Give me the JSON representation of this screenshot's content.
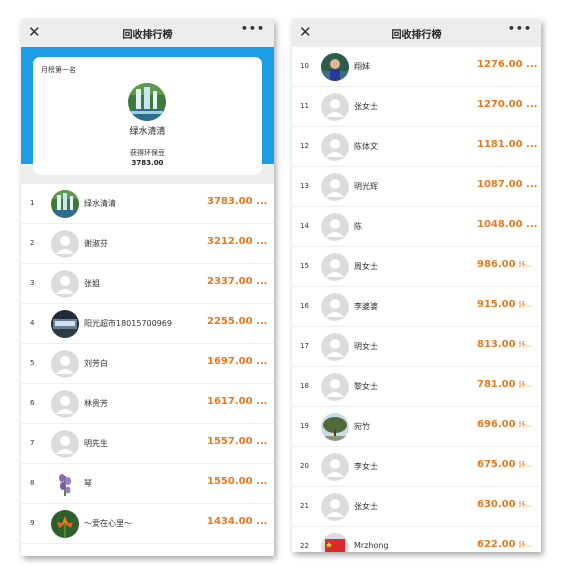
{
  "left_panel": {
    "title": "回收排行榜",
    "close_icon": "close-icon",
    "more_icon": "more-icon",
    "top_card": {
      "label": "月榜第一名",
      "name": "绿水清清",
      "caption": "获得环保豆",
      "value": "3783.00"
    },
    "rows": [
      {
        "rank": "1",
        "name": "绿水清清",
        "value": "3783.00 ...",
        "avatar": "waterfall"
      },
      {
        "rank": "2",
        "name": "谢淑芬",
        "value": "3212.00 ...",
        "avatar": "default"
      },
      {
        "rank": "3",
        "name": "张姐",
        "value": "2337.00 ...",
        "avatar": "default"
      },
      {
        "rank": "4",
        "name": "阳光超市18015700969",
        "value": "2255.00 ...",
        "avatar": "storefront"
      },
      {
        "rank": "5",
        "name": "刘芳白",
        "value": "1697.00 ...",
        "avatar": "default"
      },
      {
        "rank": "6",
        "name": "林贵芳",
        "value": "1617.00 ...",
        "avatar": "default"
      },
      {
        "rank": "7",
        "name": "明先生",
        "value": "1557.00 ...",
        "avatar": "default"
      },
      {
        "rank": "8",
        "name": "琴",
        "value": "1550.00 ...",
        "avatar": "flower"
      },
      {
        "rank": "9",
        "name": "～爱在心里～",
        "value": "1434.00 ...",
        "avatar": "lily"
      }
    ]
  },
  "right_panel": {
    "title": "回收排行榜",
    "close_icon": "close-icon",
    "more_icon": "more-icon",
    "rows": [
      {
        "rank": "10",
        "name": "翔妹",
        "value": "1276.00 ...",
        "unit": "",
        "avatar": "person-photo"
      },
      {
        "rank": "11",
        "name": "张女士",
        "value": "1270.00 ...",
        "unit": "",
        "avatar": "default"
      },
      {
        "rank": "12",
        "name": "陈体文",
        "value": "1181.00 ...",
        "unit": "",
        "avatar": "default"
      },
      {
        "rank": "13",
        "name": "明光辉",
        "value": "1087.00 ...",
        "unit": "",
        "avatar": "default"
      },
      {
        "rank": "14",
        "name": "陈",
        "value": "1048.00 ...",
        "unit": "",
        "avatar": "default"
      },
      {
        "rank": "15",
        "name": "周女士",
        "value": "986.00",
        "unit": "环...",
        "avatar": "default"
      },
      {
        "rank": "16",
        "name": "李婆婆",
        "value": "915.00",
        "unit": "环...",
        "avatar": "default"
      },
      {
        "rank": "17",
        "name": "明女士",
        "value": "813.00",
        "unit": "环...",
        "avatar": "default"
      },
      {
        "rank": "18",
        "name": "黎女士",
        "value": "781.00",
        "unit": "环...",
        "avatar": "default"
      },
      {
        "rank": "19",
        "name": "宛竹",
        "value": "696.00",
        "unit": "环...",
        "avatar": "tree"
      },
      {
        "rank": "20",
        "name": "李女士",
        "value": "675.00",
        "unit": "环...",
        "avatar": "default"
      },
      {
        "rank": "21",
        "name": "张女士",
        "value": "630.00",
        "unit": "环...",
        "avatar": "default"
      },
      {
        "rank": "22",
        "name": "Mrzhong",
        "value": "622.00",
        "unit": "环...",
        "avatar": "red-flag"
      }
    ]
  },
  "colors": {
    "accent_orange": "#e87a1e",
    "header_blue": "#1c9de6",
    "page_gray": "#ededed"
  }
}
